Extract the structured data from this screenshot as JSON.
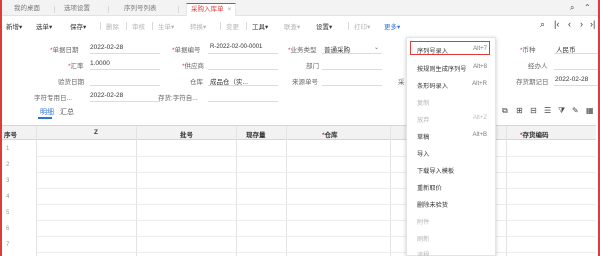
{
  "tabs": [
    {
      "label": "我的桌面"
    },
    {
      "label": "选项设置"
    },
    {
      "label": "序列号列表"
    },
    {
      "label": "采购入库单",
      "active": true,
      "close": "×"
    }
  ],
  "toolbar": {
    "new": "新增",
    "new_caret": "▾",
    "select_order": "选单",
    "save": "保存",
    "delete": "删除",
    "audit": "审核",
    "generate": "生单",
    "transfer": "转换",
    "change": "变更",
    "tools": "工具",
    "query": "联查",
    "settings": "设置",
    "print": "打印",
    "more": "更多",
    "caret": "▾"
  },
  "form": {
    "doc_date": {
      "label": "单据日期",
      "value": "2022-02-28"
    },
    "doc_no": {
      "label": "单据编号",
      "value": "R-2022-02-00-0001"
    },
    "biz_type": {
      "label": "业务类型",
      "value": "普通采购"
    },
    "currency": {
      "label": "币种",
      "value": "人民币"
    },
    "rate": {
      "label": "汇率",
      "value": "1.0000"
    },
    "supplier": {
      "label": "供应商",
      "value": ""
    },
    "dept": {
      "label": "部门",
      "value": ""
    },
    "salesman": {
      "label": "经办人",
      "value": ""
    },
    "inspect_date": {
      "label": "验货日期",
      "value": ""
    },
    "warehouse": {
      "label": "仓库",
      "value": "成品仓（实..."
    },
    "source_no": {
      "label": "来源单号",
      "value": ""
    },
    "stock_post_date": {
      "label": "存货期记日",
      "value": "2022-02-28"
    },
    "field_partial": {
      "label": "采"
    },
    "special_date": {
      "label": "字符专用日...",
      "value": "2022-02-28"
    },
    "stock_text": {
      "label": "存货:字符自...",
      "value": ""
    }
  },
  "subtabs": {
    "detail": "明细",
    "summary": "汇总"
  },
  "grid": {
    "headers": [
      {
        "label": "序号"
      },
      {
        "label": "Z"
      },
      {
        "label": "批号"
      },
      {
        "label": "现存量"
      },
      {
        "label": "仓库",
        "required": true
      },
      {
        "label": "存货编码",
        "required": true
      }
    ],
    "row_numbers": [
      "1",
      "2",
      "3",
      "4",
      "5",
      "6",
      "7"
    ]
  },
  "menu": {
    "items": [
      {
        "label": "序列号录入",
        "key": "Alt+7",
        "highlighted": true
      },
      {
        "label": "按规则生成序列号",
        "key": "Alt+8"
      },
      {
        "label": "条形码录入",
        "key": "Alt+R"
      },
      {
        "label": "复制",
        "disabled": true
      },
      {
        "label": "放弃",
        "key": "Alt+Z",
        "disabled": true
      },
      {
        "label": "草稿",
        "key": "Alt+B"
      },
      {
        "label": "导入"
      },
      {
        "label": "下载导入模板"
      },
      {
        "label": "重新取价"
      },
      {
        "label": "删除未验货"
      },
      {
        "label": "附件",
        "disabled": true
      },
      {
        "label": "刷新",
        "disabled": true
      },
      {
        "label": "流程",
        "disabled": true
      }
    ]
  },
  "colors": {
    "accent_red": "#e03a3a",
    "link_blue": "#2d74d9"
  }
}
